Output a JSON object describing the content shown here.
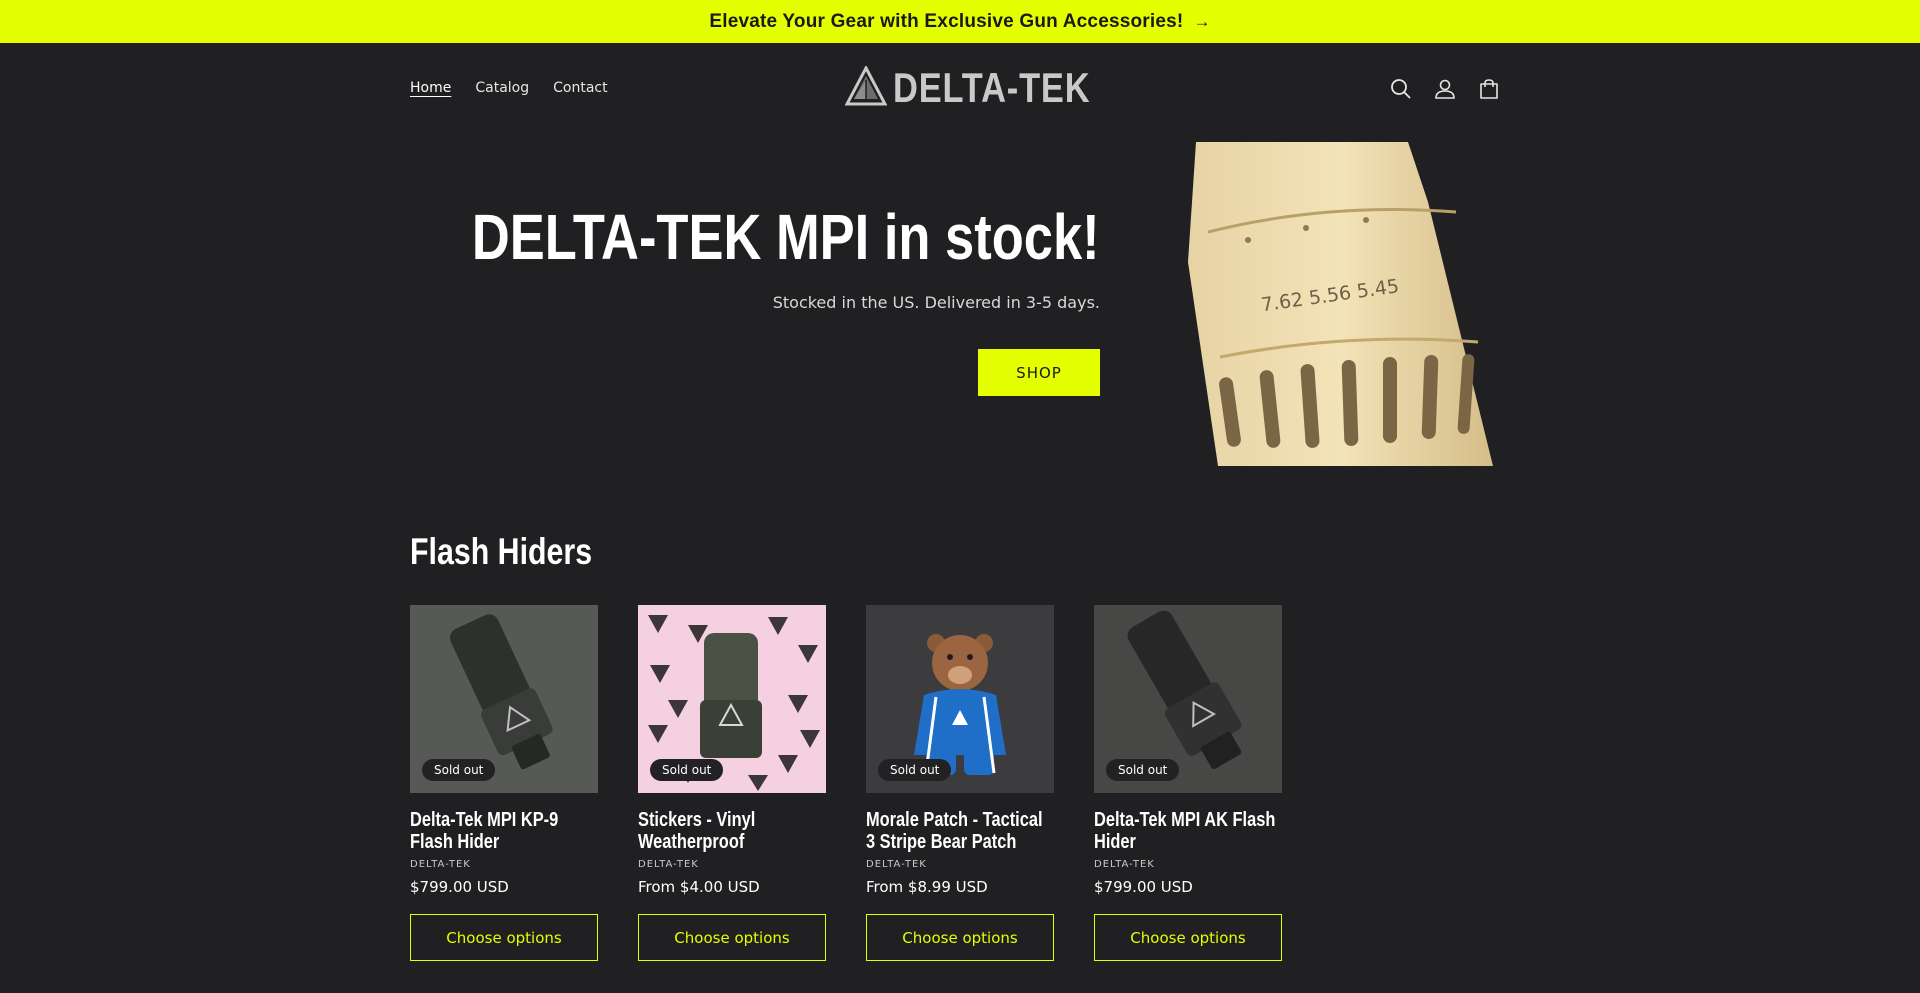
{
  "announcement": {
    "text": "Elevate Your Gear with Exclusive Gun Accessories!",
    "arrow": "→"
  },
  "nav": [
    {
      "label": "Home",
      "active": true
    },
    {
      "label": "Catalog",
      "active": false
    },
    {
      "label": "Contact",
      "active": false
    }
  ],
  "logo": {
    "text": "DELTA-TEK"
  },
  "header_icons": [
    "search-icon",
    "account-icon",
    "cart-icon"
  ],
  "hero": {
    "title": "DELTA-TEK MPI in stock!",
    "subtitle": "Stocked in the US. Delivered in 3-5 days.",
    "button": "SHOP",
    "image_engraving": "7.62  5.56  5.45"
  },
  "section": {
    "title": "Flash Hiders"
  },
  "products": [
    {
      "title": "Delta-Tek MPI KP-9 Flash Hider",
      "vendor": "DELTA-TEK",
      "price": "$799.00 USD",
      "badge": "Sold out",
      "button": "Choose options"
    },
    {
      "title": "Stickers - Vinyl Weatherproof",
      "vendor": "DELTA-TEK",
      "price": "From $4.00 USD",
      "badge": "Sold out",
      "button": "Choose options"
    },
    {
      "title": "Morale Patch - Tactical 3 Stripe Bear Patch",
      "vendor": "DELTA-TEK",
      "price": "From $8.99 USD",
      "badge": "Sold out",
      "button": "Choose options"
    },
    {
      "title": "Delta-Tek MPI AK Flash Hider",
      "vendor": "DELTA-TEK",
      "price": "$799.00 USD",
      "badge": "Sold out",
      "button": "Choose options"
    }
  ],
  "colors": {
    "accent": "#e4ff00",
    "background": "#202022",
    "text": "#ffffff"
  }
}
